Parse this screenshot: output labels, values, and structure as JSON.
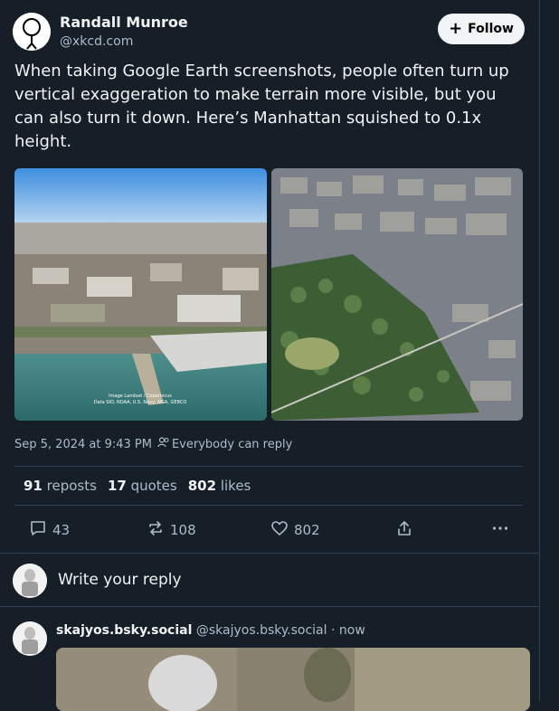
{
  "author": {
    "name": "Randall Munroe",
    "handle": "@xkcd.com"
  },
  "follow_label": "Follow",
  "post": {
    "text": "When taking Google Earth screenshots, people often turn up vertical exaggeration to make terrain more visible, but you can also turn it down. Here’s Manhattan squished to 0.1x height.",
    "image1_caption": "Image Landsat / Copernicus\nData SIO, NOAA, U.S. Navy, NGA, GEBCO",
    "timestamp": "Sep 5, 2024 at 9:43 PM",
    "audience": "Everybody can reply"
  },
  "stats": {
    "reposts_count": "91",
    "reposts_label": "reposts",
    "quotes_count": "17",
    "quotes_label": "quotes",
    "likes_count": "802",
    "likes_label": "likes"
  },
  "actions": {
    "replies": "43",
    "reposts": "108",
    "likes": "802"
  },
  "reply_prompt": "Write your reply",
  "reply": {
    "name": "skajyos.bsky.social",
    "handle": "@skajyos.bsky.social",
    "time": "· now"
  },
  "colors": {
    "background": "#161e27",
    "text": "#f1f3f5",
    "muted": "#aebbc9",
    "divider": "#2e4052"
  },
  "icons": [
    "plus-icon",
    "people-icon",
    "comment-icon",
    "repost-icon",
    "heart-icon",
    "share-icon",
    "more-icon"
  ]
}
